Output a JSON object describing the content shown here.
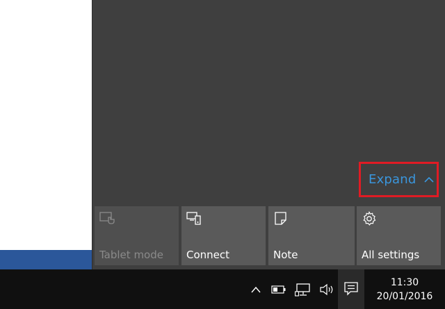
{
  "action_center": {
    "expand_label": "Expand",
    "quick_actions": [
      {
        "label": "Tablet mode",
        "icon": "tablet-mode-icon",
        "enabled": false
      },
      {
        "label": "Connect",
        "icon": "connect-icon",
        "enabled": true
      },
      {
        "label": "Note",
        "icon": "note-icon",
        "enabled": true
      },
      {
        "label": "All settings",
        "icon": "gear-icon",
        "enabled": true
      }
    ],
    "highlight_color": "#e01b24",
    "link_color": "#3a96dd"
  },
  "taskbar": {
    "tray_icons": [
      "show-hidden-icons-icon",
      "battery-icon",
      "network-icon",
      "volume-icon",
      "action-center-icon"
    ],
    "clock": {
      "time": "11:30",
      "date": "20/01/2016"
    }
  }
}
